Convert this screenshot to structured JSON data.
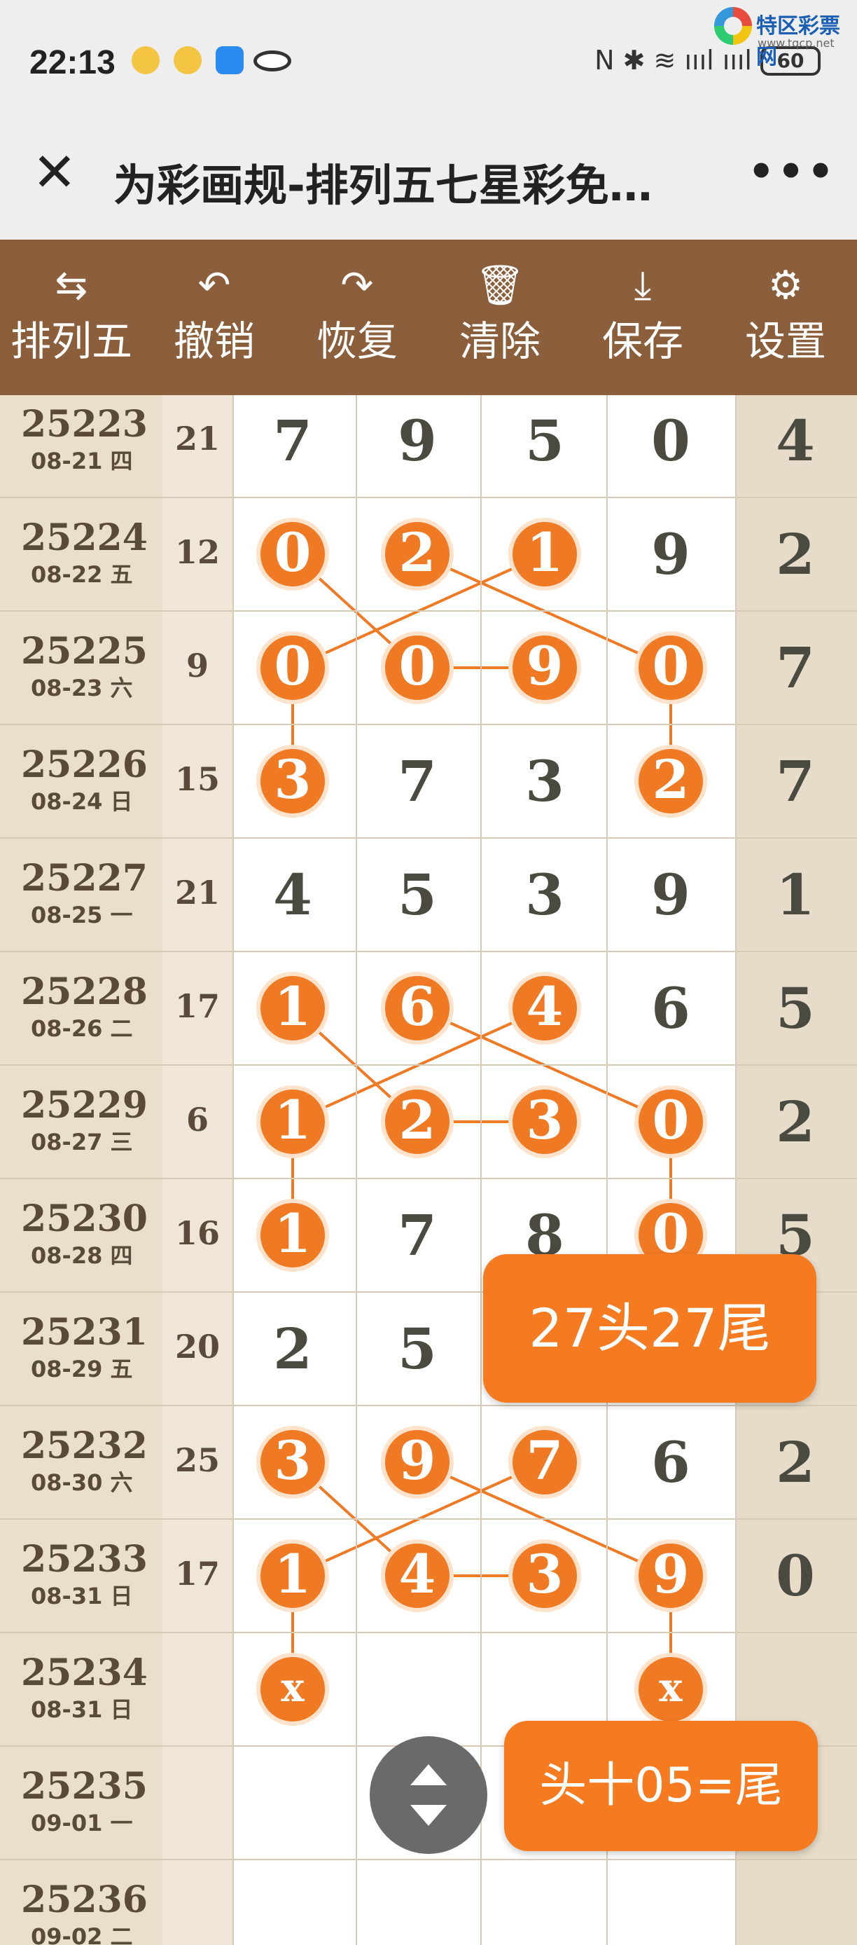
{
  "status_bar": {
    "time": "22:13",
    "battery": "60",
    "signal_text": "N ✱ ≋ ıııl ıııl"
  },
  "watermark": {
    "name": "特区彩票网",
    "url": "www.tqcp.net"
  },
  "title_bar": {
    "close_icon": "close-icon",
    "title": "为彩画规-排列五七星彩免…",
    "more_label": "•••"
  },
  "toolbar": {
    "items": [
      {
        "icon": "⇆",
        "label": "排列五",
        "icon_name": "swap-icon"
      },
      {
        "icon": "↶",
        "label": "撤销",
        "icon_name": "undo-icon"
      },
      {
        "icon": "↷",
        "label": "恢复",
        "icon_name": "redo-icon"
      },
      {
        "icon": "🗑",
        "label": "清除",
        "icon_name": "trash-icon"
      },
      {
        "icon": "⤓",
        "label": "保存",
        "icon_name": "download-icon"
      },
      {
        "icon": "⚙",
        "label": "设置",
        "icon_name": "gear-icon"
      }
    ]
  },
  "rows": [
    {
      "issue": "25223",
      "date": "08-21 四",
      "sum": "21",
      "digits": [
        "7",
        "9",
        "5",
        "0"
      ],
      "last": "4",
      "marked": [
        false,
        false,
        false,
        false
      ]
    },
    {
      "issue": "25224",
      "date": "08-22 五",
      "sum": "12",
      "digits": [
        "0",
        "2",
        "1",
        "9"
      ],
      "last": "2",
      "marked": [
        true,
        true,
        true,
        false
      ]
    },
    {
      "issue": "25225",
      "date": "08-23 六",
      "sum": "9",
      "digits": [
        "0",
        "0",
        "9",
        "0"
      ],
      "last": "7",
      "marked": [
        true,
        true,
        true,
        true
      ]
    },
    {
      "issue": "25226",
      "date": "08-24 日",
      "sum": "15",
      "digits": [
        "3",
        "7",
        "3",
        "2"
      ],
      "last": "7",
      "marked": [
        true,
        false,
        false,
        true
      ]
    },
    {
      "issue": "25227",
      "date": "08-25 一",
      "sum": "21",
      "digits": [
        "4",
        "5",
        "3",
        "9"
      ],
      "last": "1",
      "marked": [
        false,
        false,
        false,
        false
      ]
    },
    {
      "issue": "25228",
      "date": "08-26 二",
      "sum": "17",
      "digits": [
        "1",
        "6",
        "4",
        "6"
      ],
      "last": "5",
      "marked": [
        true,
        true,
        true,
        false
      ]
    },
    {
      "issue": "25229",
      "date": "08-27 三",
      "sum": "6",
      "digits": [
        "1",
        "2",
        "3",
        "0"
      ],
      "last": "2",
      "marked": [
        true,
        true,
        true,
        true
      ]
    },
    {
      "issue": "25230",
      "date": "08-28 四",
      "sum": "16",
      "digits": [
        "1",
        "7",
        "8",
        "0"
      ],
      "last": "5",
      "marked": [
        true,
        false,
        false,
        true
      ]
    },
    {
      "issue": "25231",
      "date": "08-29 五",
      "sum": "20",
      "digits": [
        "2",
        "5",
        "",
        ""
      ],
      "last": "",
      "marked": [
        false,
        false,
        false,
        false
      ]
    },
    {
      "issue": "25232",
      "date": "08-30 六",
      "sum": "25",
      "digits": [
        "3",
        "9",
        "7",
        "6"
      ],
      "last": "2",
      "marked": [
        true,
        true,
        true,
        false
      ]
    },
    {
      "issue": "25233",
      "date": "08-31 日",
      "sum": "17",
      "digits": [
        "1",
        "4",
        "3",
        "9"
      ],
      "last": "0",
      "marked": [
        true,
        true,
        true,
        true
      ]
    },
    {
      "issue": "25234",
      "date": "08-31 日",
      "sum": "",
      "digits": [
        "x",
        "",
        "",
        "x"
      ],
      "last": "",
      "marked": [
        true,
        false,
        false,
        true
      ]
    },
    {
      "issue": "25235",
      "date": "09-01 一",
      "sum": "",
      "digits": [
        "",
        "",
        "",
        ""
      ],
      "last": "",
      "marked": [
        false,
        false,
        false,
        false
      ]
    },
    {
      "issue": "25236",
      "date": "09-02 二",
      "sum": "",
      "digits": [
        "",
        "",
        "",
        ""
      ],
      "last": "",
      "marked": [
        false,
        false,
        false,
        false
      ]
    }
  ],
  "badges": {
    "badge1": "27头27尾",
    "badge2": "头十05=尾"
  },
  "colors": {
    "toolbar": "#8b5e3c",
    "ball": "#f07a24",
    "badge": "#f57a20",
    "sidebar": "#eadfcd"
  }
}
